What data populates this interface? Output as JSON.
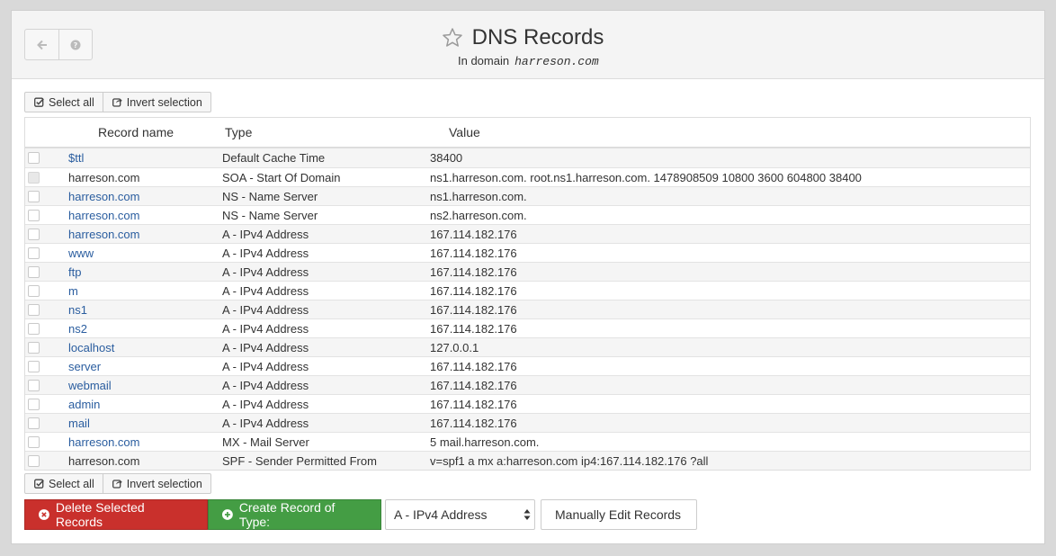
{
  "header": {
    "title": "DNS Records",
    "subtitle_prefix": "In domain",
    "domain": "harreson.com"
  },
  "selection": {
    "select_all": "Select all",
    "invert": "Invert selection"
  },
  "table": {
    "columns": [
      "Record name",
      "Type",
      "Value"
    ],
    "rows": [
      {
        "name": "$ttl",
        "type": "Default Cache Time",
        "value": "38400",
        "link": true,
        "disabled": false
      },
      {
        "name": "harreson.com",
        "type": "SOA - Start Of Domain",
        "value": "ns1.harreson.com. root.ns1.harreson.com. 1478908509 10800 3600 604800 38400",
        "link": false,
        "disabled": true
      },
      {
        "name": "harreson.com",
        "type": "NS - Name Server",
        "value": "ns1.harreson.com.",
        "link": true,
        "disabled": false
      },
      {
        "name": "harreson.com",
        "type": "NS - Name Server",
        "value": "ns2.harreson.com.",
        "link": true,
        "disabled": false
      },
      {
        "name": "harreson.com",
        "type": "A - IPv4 Address",
        "value": "167.114.182.176",
        "link": true,
        "disabled": false
      },
      {
        "name": "www",
        "type": "A - IPv4 Address",
        "value": "167.114.182.176",
        "link": true,
        "disabled": false
      },
      {
        "name": "ftp",
        "type": "A - IPv4 Address",
        "value": "167.114.182.176",
        "link": true,
        "disabled": false
      },
      {
        "name": "m",
        "type": "A - IPv4 Address",
        "value": "167.114.182.176",
        "link": true,
        "disabled": false
      },
      {
        "name": "ns1",
        "type": "A - IPv4 Address",
        "value": "167.114.182.176",
        "link": true,
        "disabled": false
      },
      {
        "name": "ns2",
        "type": "A - IPv4 Address",
        "value": "167.114.182.176",
        "link": true,
        "disabled": false
      },
      {
        "name": "localhost",
        "type": "A - IPv4 Address",
        "value": "127.0.0.1",
        "link": true,
        "disabled": false
      },
      {
        "name": "server",
        "type": "A - IPv4 Address",
        "value": "167.114.182.176",
        "link": true,
        "disabled": false
      },
      {
        "name": "webmail",
        "type": "A - IPv4 Address",
        "value": "167.114.182.176",
        "link": true,
        "disabled": false
      },
      {
        "name": "admin",
        "type": "A - IPv4 Address",
        "value": "167.114.182.176",
        "link": true,
        "disabled": false
      },
      {
        "name": "mail",
        "type": "A - IPv4 Address",
        "value": "167.114.182.176",
        "link": true,
        "disabled": false
      },
      {
        "name": "harreson.com",
        "type": "MX - Mail Server",
        "value": "5 mail.harreson.com.",
        "link": true,
        "disabled": false
      },
      {
        "name": "harreson.com",
        "type": "SPF - Sender Permitted From",
        "value": "v=spf1 a mx a:harreson.com ip4:167.114.182.176 ?all",
        "link": false,
        "disabled": false
      }
    ]
  },
  "actions": {
    "delete_label": "Delete Selected Records",
    "create_label": "Create Record of Type:",
    "record_type_selected": "A - IPv4 Address",
    "manual_edit_label": "Manually Edit Records"
  },
  "icons": {
    "back": "arrow-left-icon",
    "help": "question-icon",
    "favorite": "star-outline-icon",
    "select_all": "check-square-icon",
    "invert": "share-square-icon",
    "delete": "times-circle-icon",
    "create": "plus-circle-icon",
    "select_arrows": "sort-icon"
  },
  "colors": {
    "danger": "#c9302c",
    "success": "#449d44",
    "link": "#2a5d9f"
  }
}
